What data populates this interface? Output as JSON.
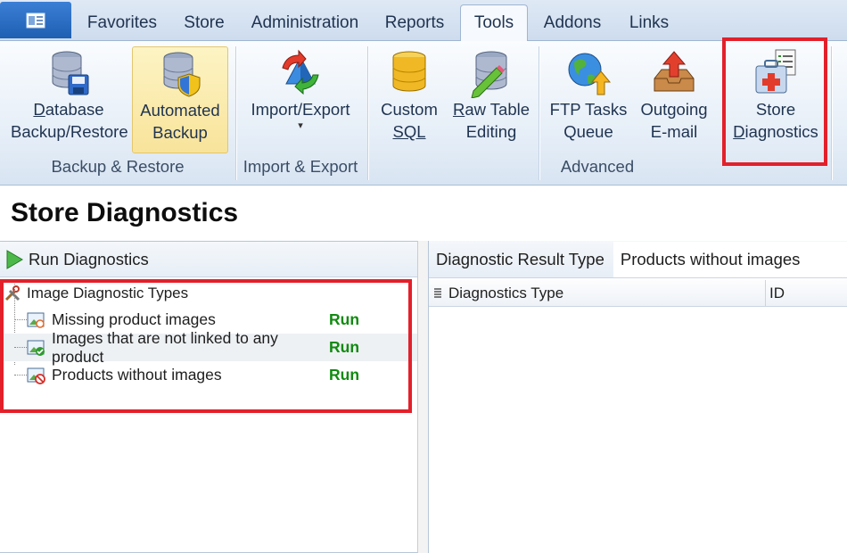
{
  "tabs": [
    {
      "label": "Favorites"
    },
    {
      "label": "Store"
    },
    {
      "label": "Administration"
    },
    {
      "label": "Reports"
    },
    {
      "label": "Tools"
    },
    {
      "label": "Addons"
    },
    {
      "label": "Links"
    }
  ],
  "active_tab": "Tools",
  "ribbon": {
    "db_backup": {
      "line1_key": "D",
      "line1_rest": "atabase",
      "line2": "Backup/Restore",
      "icon": "database-save-icon"
    },
    "auto_backup": {
      "line1": "Automated",
      "line2": "Backup",
      "icon": "database-shield-icon"
    },
    "backup_group": "Backup & Restore",
    "import_export": {
      "line1": "Import/Export",
      "arrow": "▾",
      "icon": "import-export-icon"
    },
    "import_group": "Import & Export",
    "custom_sql": {
      "line1": "Custom",
      "line2": "SQL",
      "icon": "sql-database-icon"
    },
    "raw_table": {
      "line1_key": "R",
      "line1_rest": "aw Table",
      "line2": "Editing",
      "icon": "table-edit-icon"
    },
    "ftp_tasks": {
      "line1": "FTP Tasks",
      "line2": "Queue",
      "icon": "globe-upload-icon"
    },
    "outgoing_email": {
      "line1": "Outgoing",
      "line2": "E-mail",
      "icon": "outbox-icon"
    },
    "advanced_group": "Advanced",
    "store_diag": {
      "line1": "Store",
      "line2_key": "D",
      "line2_rest": "iagnostics",
      "icon": "medical-kit-icon"
    }
  },
  "page_title": "Store Diagnostics",
  "left": {
    "run_label": "Run Diagnostics",
    "tree_root": "Image Diagnostic Types",
    "items": [
      {
        "label": "Missing product images",
        "action": "Run"
      },
      {
        "label": "Images that are not linked to any product",
        "action": "Run"
      },
      {
        "label": "Products without images",
        "action": "Run"
      }
    ]
  },
  "right": {
    "result_type_label": "Diagnostic Result Type",
    "result_type_value": "Products without images",
    "columns": [
      "Diagnostics Type",
      "ID"
    ]
  },
  "colors": {
    "highlight": "#e3202a",
    "run_text": "#118a11",
    "accent": "#1f5fb2"
  }
}
